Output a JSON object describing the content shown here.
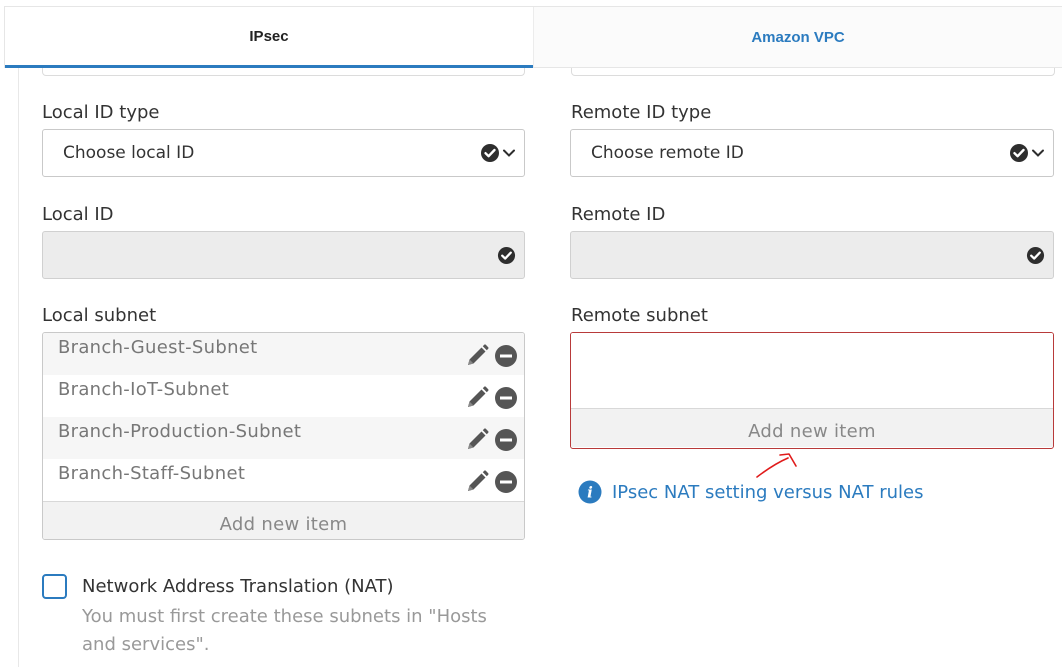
{
  "tabs": [
    {
      "label": "IPsec",
      "active": true
    },
    {
      "label": "Amazon VPC",
      "active": false
    }
  ],
  "local_id_type": {
    "label": "Local ID type",
    "value": "Choose local ID"
  },
  "remote_id_type": {
    "label": "Remote ID type",
    "value": "Choose remote ID"
  },
  "local_id": {
    "label": "Local ID",
    "value": ""
  },
  "remote_id": {
    "label": "Remote ID",
    "value": ""
  },
  "local_subnet": {
    "label": "Local subnet",
    "items": [
      "Branch-Guest-Subnet",
      "Branch-IoT-Subnet",
      "Branch-Production-Subnet",
      "Branch-Staff-Subnet"
    ],
    "add_label": "Add new item"
  },
  "remote_subnet": {
    "label": "Remote subnet",
    "items": [],
    "add_label": "Add new item"
  },
  "info_link": {
    "text": "IPsec NAT setting versus NAT rules",
    "icon": "info-icon"
  },
  "nat": {
    "label": "Network Address Translation (NAT)",
    "checked": false,
    "hint": "You must first create these subnets in \"Hosts and services\"."
  },
  "colors": {
    "accent": "#2b7bbf",
    "error_border": "#b83a3a",
    "icon_gray": "#555555",
    "annotation": "#e01b1b"
  }
}
